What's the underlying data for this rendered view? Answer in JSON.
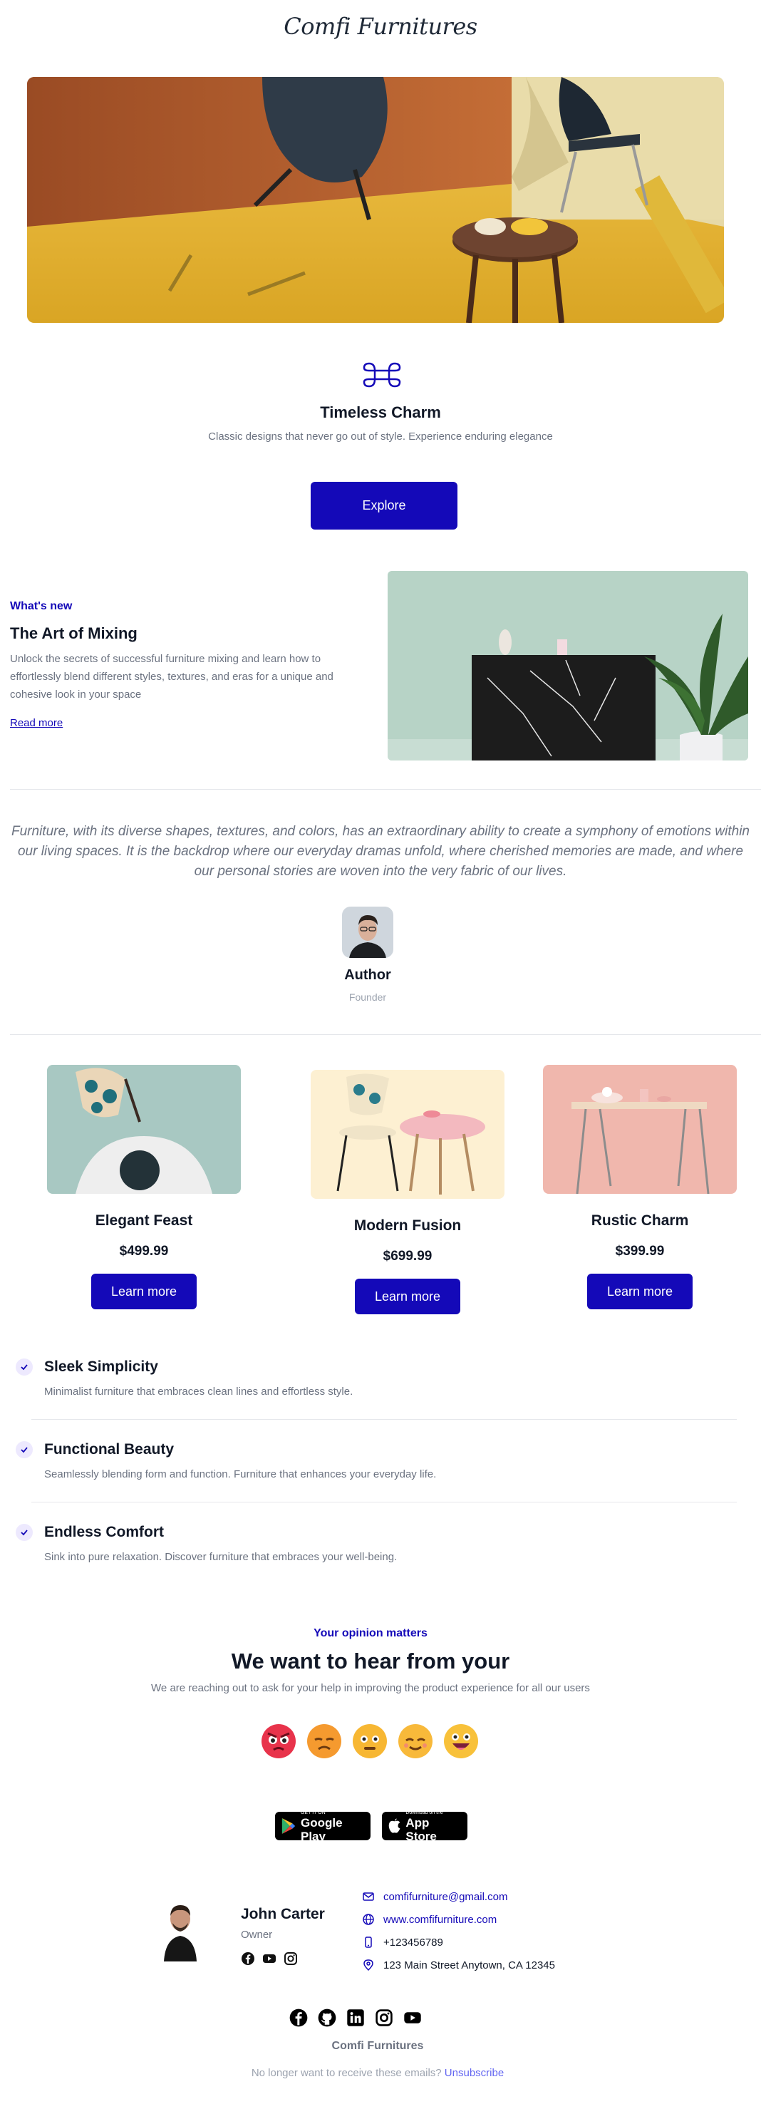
{
  "brand": {
    "logo": "Comfi Furnitures"
  },
  "hero": {
    "title": "Timeless Charm",
    "subtitle": "Classic designs that never go out of style. Experience enduring elegance",
    "button": "Explore"
  },
  "whats_new": {
    "eyebrow": "What's new",
    "title": "The Art of Mixing",
    "body": "Unlock the secrets of successful furniture mixing and learn how to effortlessly blend different styles, textures, and eras for a unique and cohesive look in your space",
    "link": "Read more"
  },
  "testimonial": {
    "quote": "Furniture, with its diverse shapes, textures, and colors, has an extraordinary ability to create a symphony of emotions within our living spaces. It is the backdrop where our everyday dramas unfold, where cherished memories are made, and where our personal stories are woven into the very fabric of our lives.",
    "author": "Author",
    "role": "Founder"
  },
  "products": [
    {
      "name": "Elegant Feast",
      "price": "$499.99",
      "button": "Learn more"
    },
    {
      "name": "Modern Fusion",
      "price": "$699.99",
      "button": "Learn more"
    },
    {
      "name": "Rustic Charm",
      "price": "$399.99",
      "button": "Learn more"
    }
  ],
  "features": [
    {
      "title": "Sleek Simplicity",
      "body": "Minimalist furniture that embraces clean lines and effortless style."
    },
    {
      "title": "Functional Beauty",
      "body": "Seamlessly blending form and function. Furniture that enhances your everyday life."
    },
    {
      "title": "Endless Comfort",
      "body": "Sink into pure relaxation. Discover furniture that embraces your well-being."
    }
  ],
  "opinion": {
    "eyebrow": "Your opinion matters",
    "title": "We want to hear from your",
    "subtitle": "We are reaching out to ask for your help in improving the product experience for all our users",
    "emojis": [
      "angry-face-icon",
      "sad-face-icon",
      "neutral-face-icon",
      "content-face-icon",
      "delighted-face-icon"
    ]
  },
  "apps": {
    "google_small": "GET IT ON",
    "google_big": "Google Play",
    "apple_small": "Download on the",
    "apple_big": "App Store"
  },
  "signature": {
    "name": "John Carter",
    "role": "Owner",
    "email": "comfifurniture@gmail.com",
    "website": "www.comfifurniture.com",
    "phone": "+123456789",
    "address": "123 Main Street Anytown, CA 12345"
  },
  "footer": {
    "brand": "Comfi Furnitures",
    "unsub_text": "No longer want to receive these emails?",
    "unsub_link": "Unsubscribe"
  },
  "colors": {
    "accent": "#1409b8",
    "muted": "#6b7280"
  }
}
